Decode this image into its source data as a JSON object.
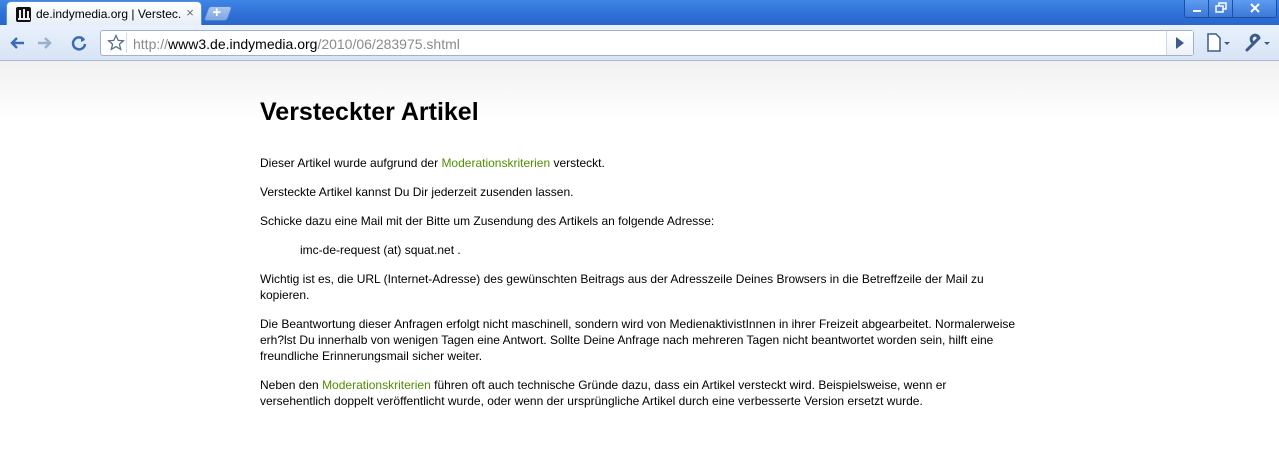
{
  "browser": {
    "tab_title": "de.indymedia.org | Verstec...",
    "tab_close": "×",
    "url_scheme": "http://",
    "url_host": "www3.de.indymedia.org",
    "url_path": "/2010/06/283975.shtml"
  },
  "page": {
    "heading": "Versteckter Artikel",
    "p1_before": "Dieser Artikel wurde aufgrund der ",
    "p1_link": "Moderationskriterien",
    "p1_after": " versteckt.",
    "p2": "Versteckte Artikel kannst Du Dir jederzeit zusenden lassen.",
    "p3": "Schicke dazu eine Mail mit der Bitte um Zusendung des Artikels an folgende Adresse:",
    "email": "imc-de-request (at) squat.net .",
    "p4": "Wichtig ist es, die URL (Internet-Adresse) des gewünschten Beitrags aus der Adresszeile Deines Browsers in die Betreffzeile der Mail zu kopieren.",
    "p5": "Die Beantwortung dieser Anfragen erfolgt nicht maschinell, sondern wird von MedienaktivistInnen in ihrer Freizeit abgearbeitet. Normalerweise erh?lst Du innerhalb von wenigen Tagen eine Antwort. Sollte Deine Anfrage nach mehreren Tagen nicht beantwortet worden sein, hilft eine freundliche Erinnerungsmail sicher weiter.",
    "p6_before": "Neben den ",
    "p6_link": "Moderationskriterien",
    "p6_after": " führen oft auch technische Gründe dazu, dass ein Artikel versteckt wird. Beispielsweise, wenn er versehentlich doppelt veröffentlicht wurde, oder wenn der ursprüngliche Artikel durch eine verbesserte Version ersetzt wurde."
  },
  "colors": {
    "link": "#4e8f00",
    "titlebar": "#2f6fd6"
  }
}
